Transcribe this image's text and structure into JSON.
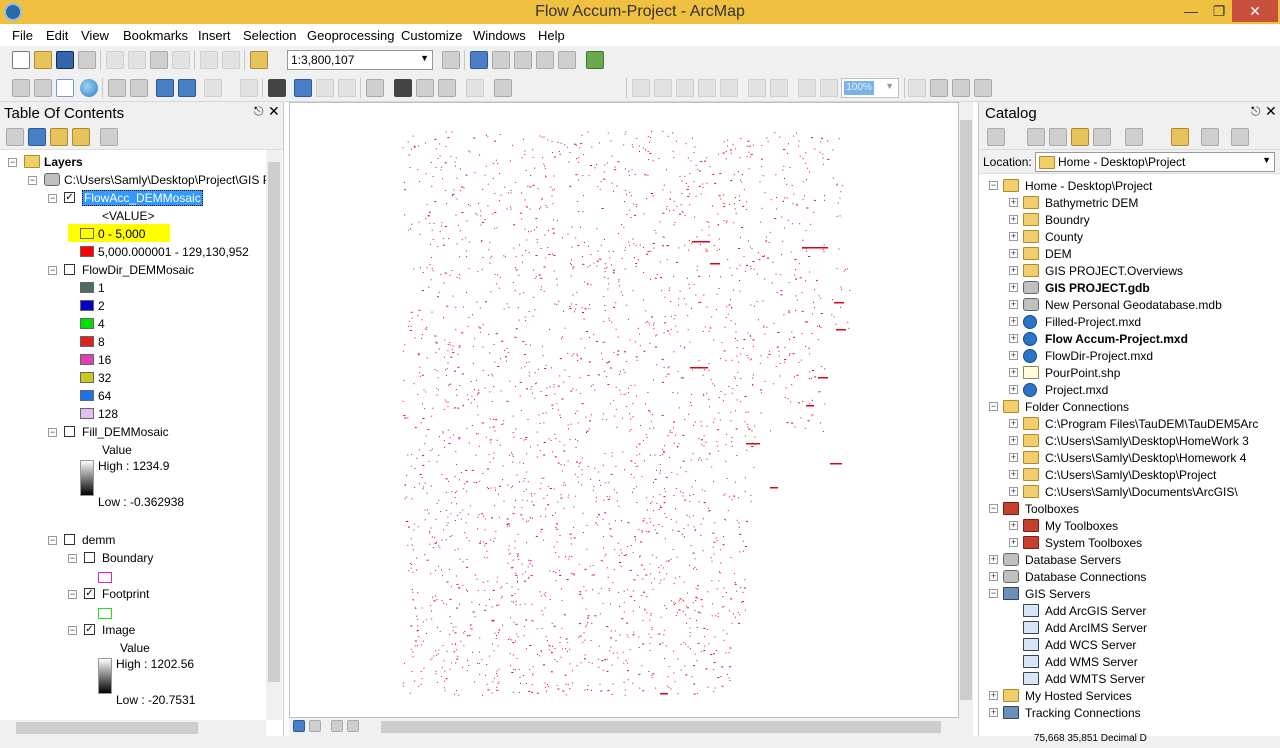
{
  "window": {
    "title": "Flow Accum-Project - ArcMap"
  },
  "menu": [
    "File",
    "Edit",
    "View",
    "Bookmarks",
    "Insert",
    "Selection",
    "Geoprocessing",
    "Customize",
    "Windows",
    "Help"
  ],
  "toolbar": {
    "scale": "1:3,800,107",
    "zoom_percent": "100%"
  },
  "toc": {
    "title": "Table Of Contents",
    "root_label": "Layers",
    "data_frame_path": "C:\\Users\\Samly\\Desktop\\Project\\GIS P",
    "flowacc": {
      "name": "FlowAcc_DEMMosaic",
      "field": "<VALUE>",
      "classes": [
        {
          "label": "0 - 5,000",
          "color": "#ffff00"
        },
        {
          "label": "5,000.000001 - 129,130,952",
          "color": "#ff0000"
        }
      ]
    },
    "flowdir": {
      "name": "FlowDir_DEMMosaic",
      "classes": [
        {
          "label": "1",
          "color": "#4d6b62"
        },
        {
          "label": "2",
          "color": "#0000c8"
        },
        {
          "label": "4",
          "color": "#00e000"
        },
        {
          "label": "8",
          "color": "#e02020"
        },
        {
          "label": "16",
          "color": "#e040b0"
        },
        {
          "label": "32",
          "color": "#c8c820"
        },
        {
          "label": "64",
          "color": "#1a73e8"
        },
        {
          "label": "128",
          "color": "#e0c0f0"
        }
      ]
    },
    "fill": {
      "name": "Fill_DEMMosaic",
      "value_label": "Value",
      "high": "High : 1234.9",
      "low": "Low : -0.362938"
    },
    "demm": {
      "name": "demm",
      "boundary": {
        "name": "Boundary",
        "color": "#e020c0"
      },
      "footprint": {
        "name": "Footprint",
        "color": "#20e020"
      },
      "image": {
        "name": "Image",
        "value_label": "Value",
        "high": "High : 1202.56",
        "low": "Low : -20.7531"
      }
    }
  },
  "catalog": {
    "title": "Catalog",
    "location_label": "Location:",
    "location_value": "Home - Desktop\\Project",
    "home": "Home - Desktop\\Project",
    "home_items": [
      {
        "label": "Bathymetric DEM",
        "icon": "folder",
        "bold": false
      },
      {
        "label": "Boundry",
        "icon": "folder",
        "bold": false
      },
      {
        "label": "County",
        "icon": "folder",
        "bold": false
      },
      {
        "label": "DEM",
        "icon": "folder",
        "bold": false
      },
      {
        "label": "GIS PROJECT.Overviews",
        "icon": "folder",
        "bold": false
      },
      {
        "label": "GIS PROJECT.gdb",
        "icon": "gdb",
        "bold": true
      },
      {
        "label": "New Personal Geodatabase.mdb",
        "icon": "gdb",
        "bold": false
      },
      {
        "label": "Filled-Project.mxd",
        "icon": "mxd",
        "bold": false
      },
      {
        "label": "Flow Accum-Project.mxd",
        "icon": "mxd",
        "bold": true
      },
      {
        "label": "FlowDir-Project.mxd",
        "icon": "mxd",
        "bold": false
      },
      {
        "label": "PourPoint.shp",
        "icon": "shp",
        "bold": false
      },
      {
        "label": "Project.mxd",
        "icon": "mxd",
        "bold": false
      }
    ],
    "folder_connections": "Folder Connections",
    "folder_items": [
      "C:\\Program Files\\TauDEM\\TauDEM5Arc",
      "C:\\Users\\Samly\\Desktop\\HomeWork 3",
      "C:\\Users\\Samly\\Desktop\\Homework 4",
      "C:\\Users\\Samly\\Desktop\\Project",
      "C:\\Users\\Samly\\Documents\\ArcGIS\\"
    ],
    "toolboxes": "Toolboxes",
    "toolbox_items": [
      "My Toolboxes",
      "System Toolboxes"
    ],
    "database_servers": "Database Servers",
    "database_connections": "Database Connections",
    "gis_servers": "GIS Servers",
    "server_items": [
      "Add ArcGIS Server",
      "Add ArcIMS Server",
      "Add WCS Server",
      "Add WMS Server",
      "Add WMTS Server"
    ],
    "hosted": "My Hosted Services",
    "tracking": "Tracking Connections"
  },
  "status": {
    "coords": "75,668  35,851  Decimal D"
  },
  "colors": {
    "title_bar": "#f0c040",
    "selection": "#3399ff",
    "stream_red": "#e0001a"
  }
}
